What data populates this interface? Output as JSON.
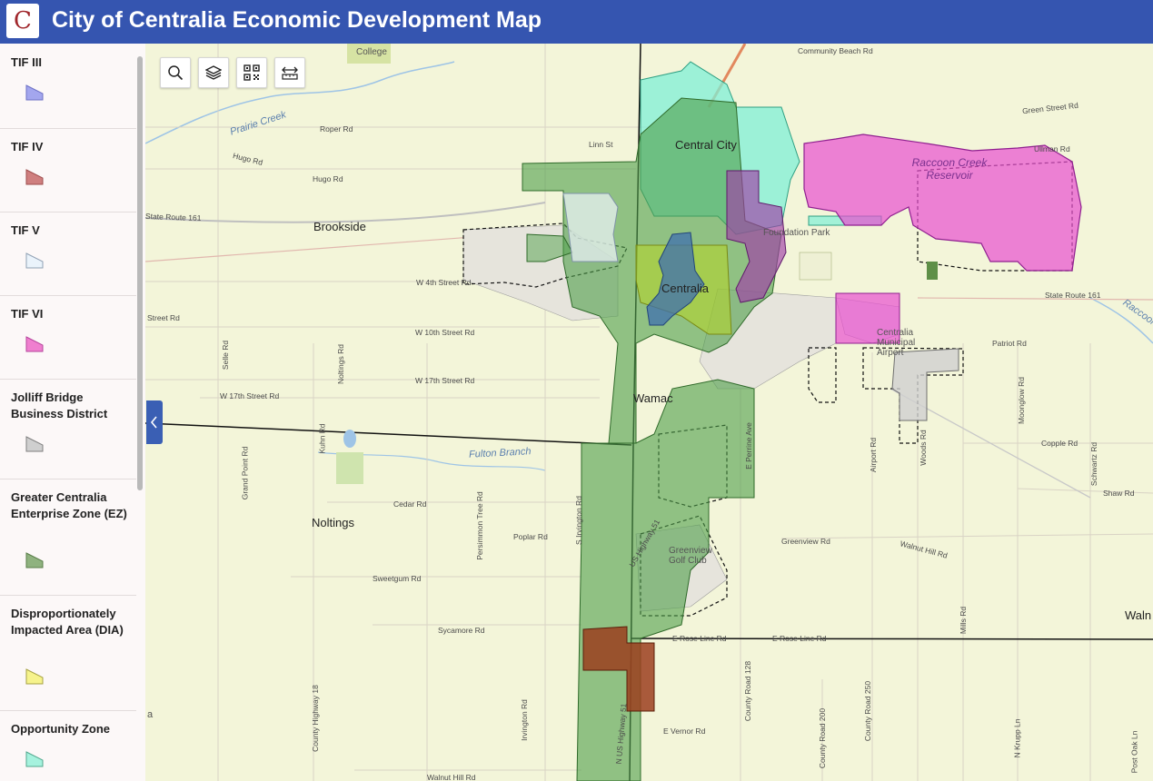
{
  "header": {
    "logo_letter": "C",
    "title": "City of Centralia Economic Development Map"
  },
  "legend": [
    {
      "label": "TIF III",
      "fill": "#a3a6ee",
      "stroke": "#6d71c5"
    },
    {
      "label": "TIF IV",
      "fill": "#cf7f7f",
      "stroke": "#9e4c4c"
    },
    {
      "label": "TIF V",
      "fill": "#eaf3fb",
      "stroke": "#8fa0b3"
    },
    {
      "label": "TIF VI",
      "fill": "#ef7fcf",
      "stroke": "#b6449c"
    },
    {
      "label": "Jolliff Bridge Business District",
      "fill": "#cfcfcf",
      "stroke": "#7f7f7f"
    },
    {
      "label": "Greater Centralia Enterprise Zone (EZ)",
      "fill": "#8fb27f",
      "stroke": "#587d48"
    },
    {
      "label": "Disproportionately Impacted Area (DIA)",
      "fill": "#f6f38c",
      "stroke": "#a6a242"
    },
    {
      "label": "Opportunity Zone",
      "fill": "#a6f2de",
      "stroke": "#52a88e"
    }
  ],
  "toolbar": {
    "search_icon": "search-icon",
    "layers_icon": "layers-icon",
    "qr_icon": "qr-code-icon",
    "measure_icon": "measure-icon"
  },
  "map": {
    "towns": {
      "central_city": "Central City",
      "brookside": "Brookside",
      "centralia": "Centralia",
      "wamac": "Wamac",
      "noltings": "Noltings",
      "walnut": "Waln"
    },
    "water": {
      "prairie_creek": "Prairie Creek",
      "fulton_branch": "Fulton Branch",
      "raccoon_creek": "Raccoon Creek",
      "reservoir": "Raccoon Creek Reservoir"
    },
    "poi": {
      "college": "College",
      "airport": "Centralia Municipal Airport",
      "golf": "Greenview Golf Club",
      "foundation_park": "Foundation Park",
      "side_letter": "a"
    },
    "roads": {
      "community_beach": "Community Beach Rd",
      "green_street": "Green Street Rd",
      "ullman": "Ullman Rd",
      "roper": "Roper Rd",
      "hugo": "Hugo Rd",
      "hugo2": "Hugo Rd",
      "linn": "Linn St",
      "sr161w": "State Route 161",
      "sr161e": "State Route 161",
      "w4th": "W 4th Street Rd",
      "street_rd": "Street Rd",
      "w10th": "W 10th Street Rd",
      "w17th": "W 17th Street Rd",
      "w17th2": "W 17th Street Rd",
      "selle": "Selle Rd",
      "noltings_rd": "Noltings Rd",
      "kuhn": "Kuhn Rd",
      "grand_point": "Grand Point Rd",
      "cedar": "Cedar Rd",
      "persimmon": "Persimmon Tree Rd",
      "poplar": "Poplar Rd",
      "sweetgum": "Sweetgum Rd",
      "sycamore": "Sycamore Rd",
      "walnut_hill": "Walnut Hill Rd",
      "walnut_hill_e": "Walnut Hill Rd",
      "greenview": "Greenview Rd",
      "copple": "Copple Rd",
      "shaw": "Shaw Rd",
      "patriot": "Patriot Rd",
      "moonglow": "Moonglow Rd",
      "airport_rd": "Airport Rd",
      "woods": "Woods Rd",
      "schwartz": "Schwartz Rd",
      "mills": "Mills Rd",
      "e_rose": "E Rose Line Rd",
      "e_rose2": "E Rose Line Rd",
      "e_vernor": "E Vernor Rd",
      "cr18": "County Highway 18",
      "cr128": "County Road 128",
      "cr200": "County Road 200",
      "cr250": "County Road 250",
      "n_us_hwy": "N US Highway 51",
      "us_hwy": "US Highway 51",
      "irvington": "Irvington Rd",
      "s_irvington": "S Irvington Rd",
      "n_krupp": "N Krupp Ln",
      "post_oak": "Post Oak Ln",
      "e_perrine": "E Perrine Ave"
    }
  }
}
